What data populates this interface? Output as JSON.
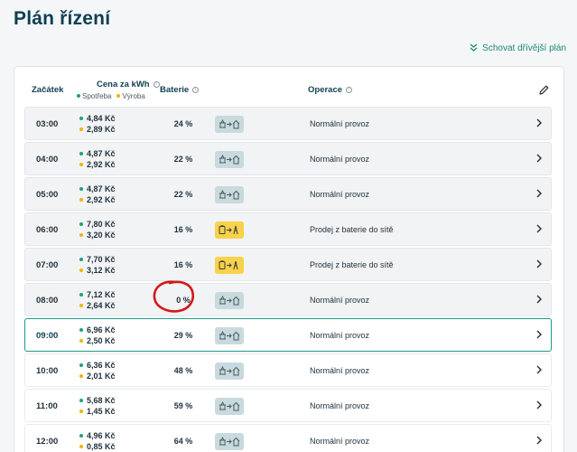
{
  "page": {
    "title": "Plán řízení"
  },
  "hide_link": {
    "label": "Schovat dřívější plán"
  },
  "columns": {
    "start": "Začátek",
    "price": "Cena za kWh",
    "battery": "Baterie",
    "operation": "Operace"
  },
  "legend": {
    "consumption": "Spotřeba",
    "production": "Výroba"
  },
  "colors": {
    "accent": "#1d9a8a",
    "consumption_dot": "#1aa37a",
    "production_dot": "#f0b400",
    "icon_gray": "#c8dadd",
    "icon_yellow": "#f7d24a",
    "annotation": "#d41818"
  },
  "rows": [
    {
      "time": "03:00",
      "consumption": "4,84 Kč",
      "production": "2,89 Kč",
      "battery": "24 %",
      "icon": "grid-to-home-icon",
      "operation": "Normální provoz"
    },
    {
      "time": "04:00",
      "consumption": "4,87 Kč",
      "production": "2,92 Kč",
      "battery": "22 %",
      "icon": "grid-to-home-icon",
      "operation": "Normální provoz"
    },
    {
      "time": "05:00",
      "consumption": "4,87 Kč",
      "production": "2,92 Kč",
      "battery": "22 %",
      "icon": "grid-to-home-icon",
      "operation": "Normální provoz"
    },
    {
      "time": "06:00",
      "consumption": "7,80 Kč",
      "production": "3,20 Kč",
      "battery": "16 %",
      "icon": "battery-to-grid-icon",
      "operation": "Prodej z baterie do sítě"
    },
    {
      "time": "07:00",
      "consumption": "7,70 Kč",
      "production": "3,12 Kč",
      "battery": "16 %",
      "icon": "battery-to-grid-icon",
      "operation": "Prodej z baterie do sítě"
    },
    {
      "time": "08:00",
      "consumption": "7,12 Kč",
      "production": "2,64 Kč",
      "battery": "0 %",
      "icon": "grid-to-home-icon",
      "operation": "Normální provoz"
    },
    {
      "time": "09:00",
      "consumption": "6,96 Kč",
      "production": "2,50 Kč",
      "battery": "29 %",
      "icon": "grid-to-home-icon",
      "operation": "Normální provoz"
    },
    {
      "time": "10:00",
      "consumption": "6,36 Kč",
      "production": "2,01 Kč",
      "battery": "48 %",
      "icon": "grid-to-home-icon",
      "operation": "Normální provoz"
    },
    {
      "time": "11:00",
      "consumption": "5,68 Kč",
      "production": "1,45 Kč",
      "battery": "59 %",
      "icon": "grid-to-home-icon",
      "operation": "Normální provoz"
    },
    {
      "time": "12:00",
      "consumption": "4,96 Kč",
      "production": "0,85 Kč",
      "battery": "64 %",
      "icon": "grid-to-home-icon",
      "operation": "Normální provoz"
    }
  ]
}
